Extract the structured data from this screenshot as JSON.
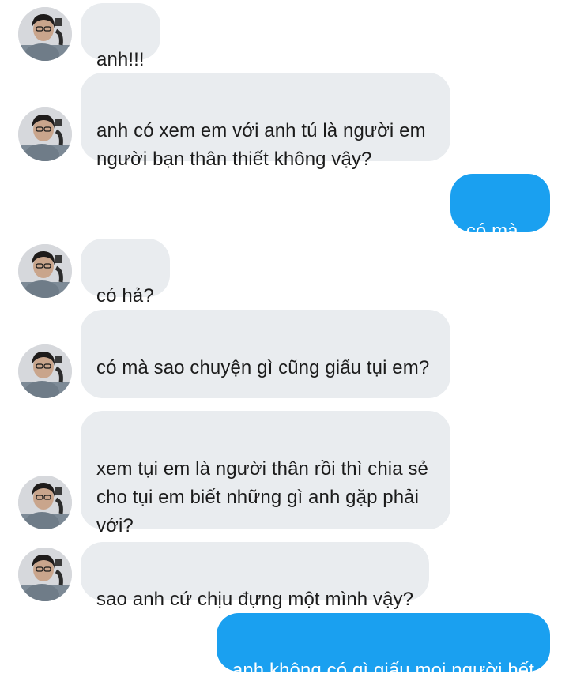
{
  "conversation": {
    "messages": [
      {
        "id": "m1",
        "sender": "other",
        "text": "anh!!!"
      },
      {
        "id": "m2",
        "sender": "other",
        "text": "anh có xem em với anh tú là người em người bạn thân thiết không vậy?"
      },
      {
        "id": "m3",
        "sender": "me",
        "text": "có mà..."
      },
      {
        "id": "m4",
        "sender": "other",
        "text": "có hả?"
      },
      {
        "id": "m5",
        "sender": "other",
        "text": "có mà sao chuyện gì cũng giấu tụi em?"
      },
      {
        "id": "m6",
        "sender": "other",
        "text": "xem tụi em là người thân rồi thì chia sẻ cho tụi em biết những gì anh gặp phải với?"
      },
      {
        "id": "m7",
        "sender": "other",
        "text": "sao anh cứ chịu đựng một mình vậy?"
      },
      {
        "id": "m8",
        "sender": "me",
        "text": "anh không có gì giấu mọi người hết"
      }
    ]
  },
  "colors": {
    "incoming_bubble": "#e9ecef",
    "outgoing_bubble": "#1aa0f0",
    "incoming_text": "#1b1b1b",
    "outgoing_text": "#ffffff"
  },
  "icons": {
    "avatar": "user-avatar-photo"
  }
}
